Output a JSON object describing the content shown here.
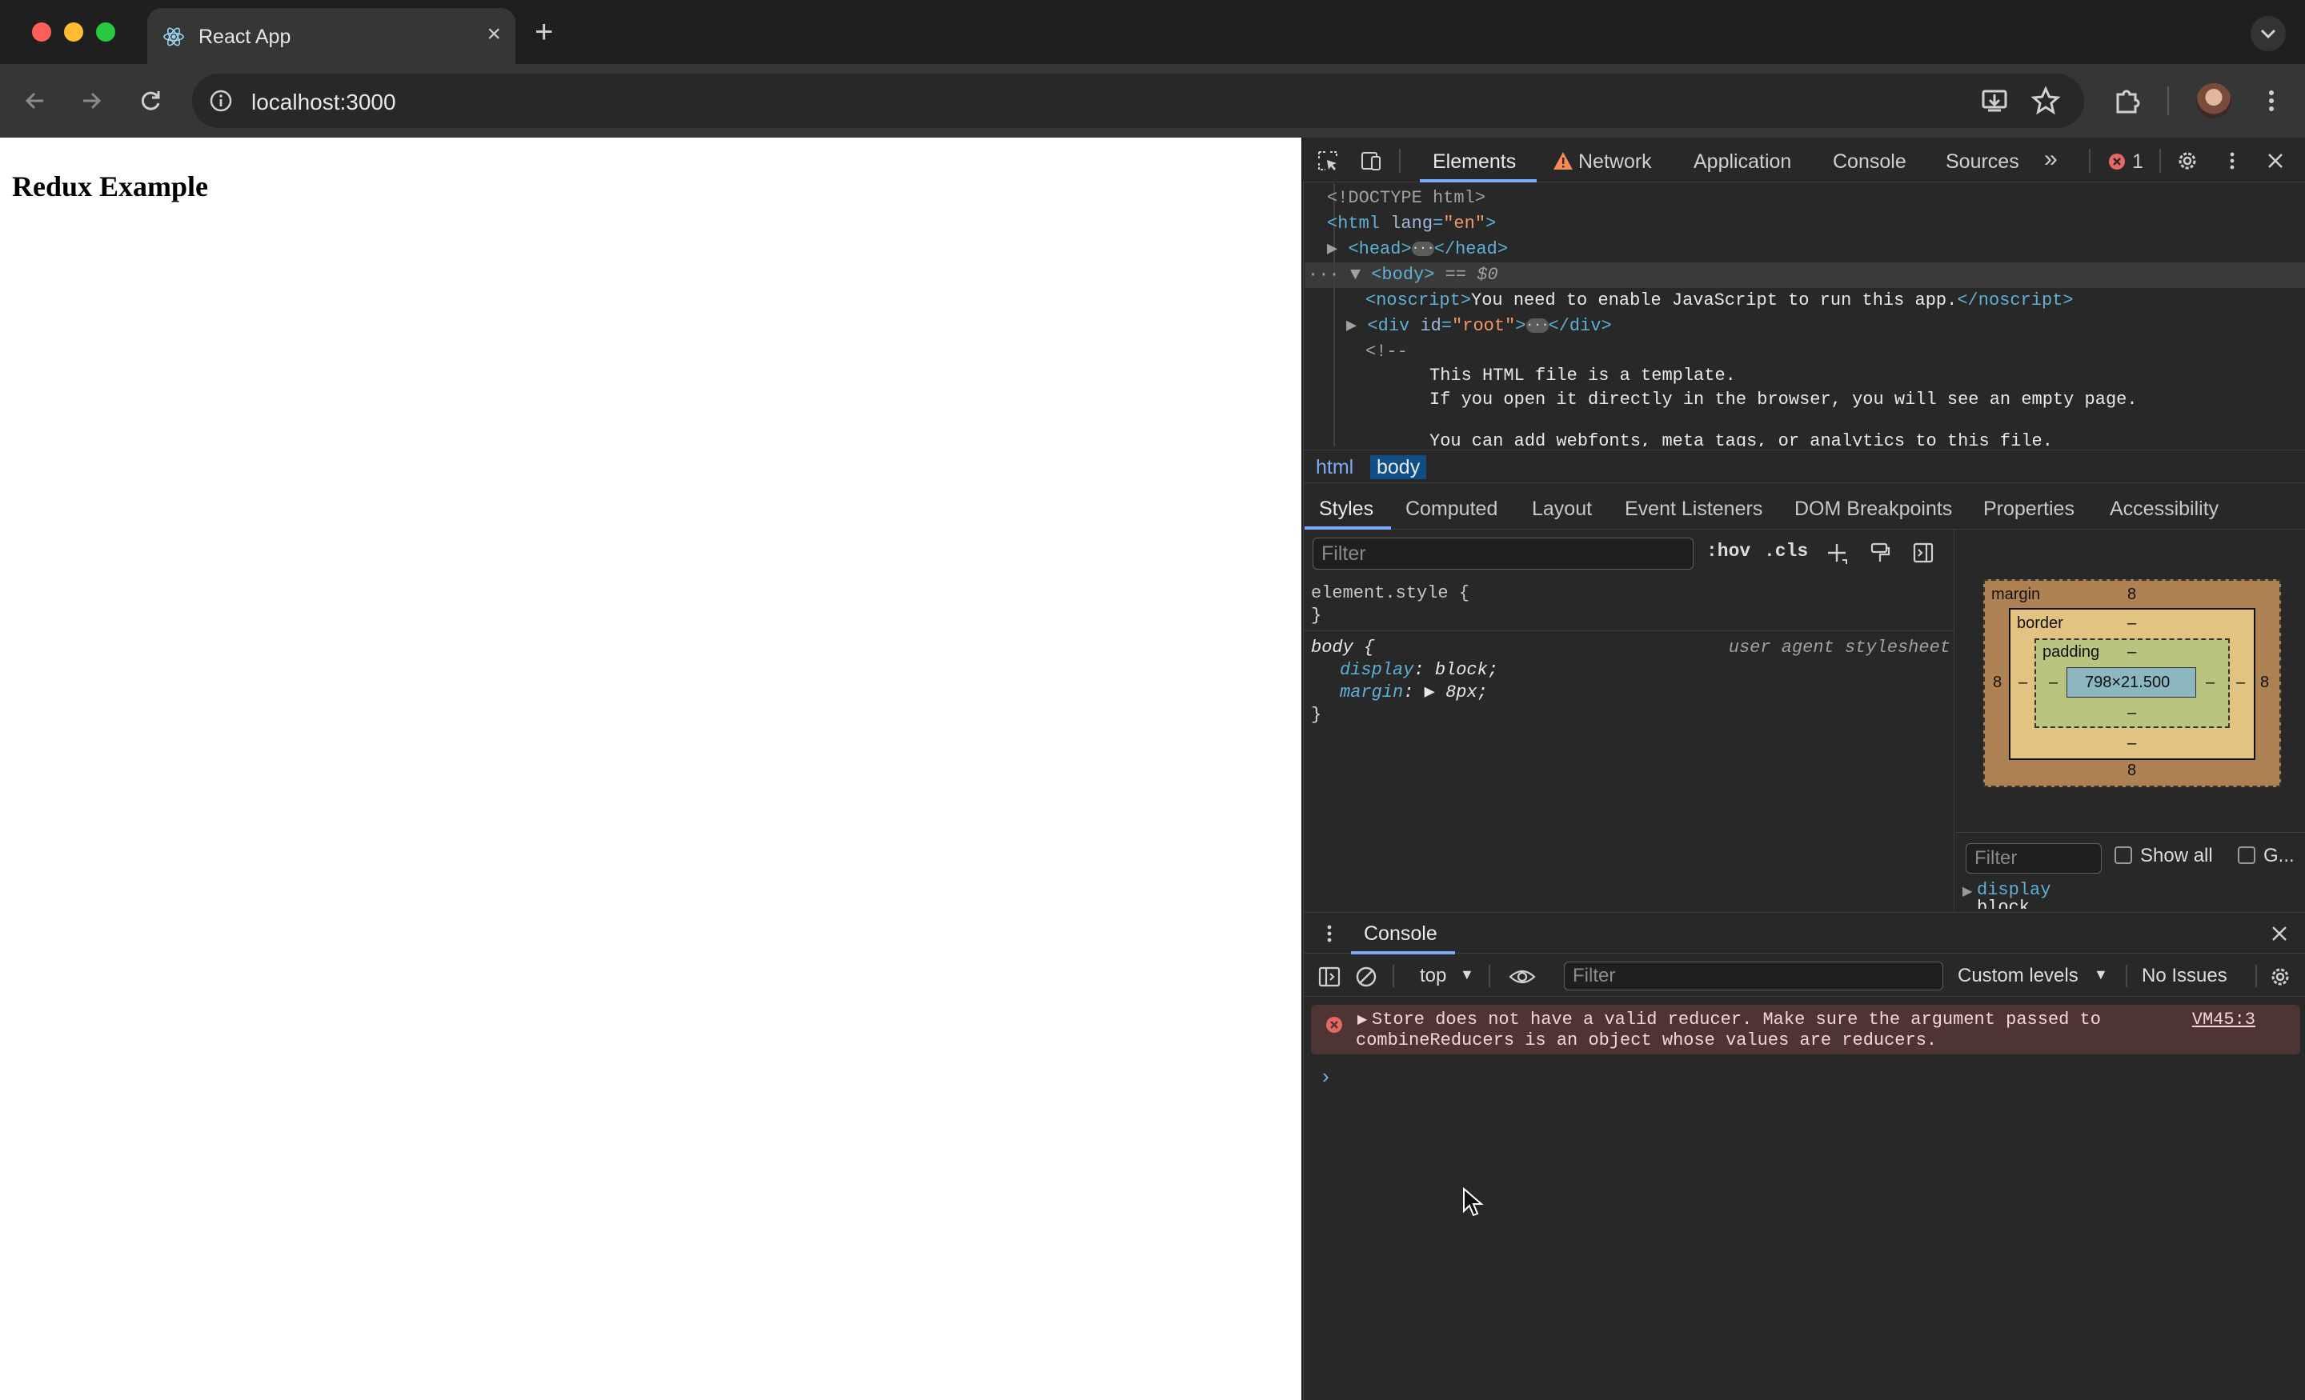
{
  "browser": {
    "tab_title": "React App",
    "tab_close": "×",
    "new_tab": "+",
    "url": "localhost:3000"
  },
  "page": {
    "heading": "Redux Example"
  },
  "devtools": {
    "tabs": {
      "elements": "Elements",
      "network": "Network",
      "application": "Application",
      "console": "Console",
      "sources": "Sources",
      "more": "»",
      "error_count": "1"
    },
    "dom": {
      "doctype": "<!DOCTYPE html>",
      "html_open": "<html",
      "lang_attr": "lang",
      "lang_val": "\"en\"",
      "gt": ">",
      "head_open": "<head>",
      "head_close": "</head>",
      "body_open": "<body>",
      "body_marker": "== $0",
      "noscript_open": "<noscript>",
      "noscript_text": "You need to enable JavaScript to run this app.",
      "noscript_close": "</noscript>",
      "div_open": "<div",
      "id_attr": "id",
      "id_val": "\"root\"",
      "div_close": "</div>",
      "comment_open": "<!--",
      "comment_line1": "This HTML file is a template.",
      "comment_line2": "If you open it directly in the browser, you will see an empty page.",
      "comment_line3": "You can add webfonts, meta tags, or analytics to this file."
    },
    "breadcrumb": [
      "html",
      "body"
    ],
    "sub_tabs": [
      "Styles",
      "Computed",
      "Layout",
      "Event Listeners",
      "DOM Breakpoints",
      "Properties",
      "Accessibility"
    ],
    "styles": {
      "filter_placeholder": "Filter",
      "hov": ":hov",
      "cls": ".cls",
      "element_style": "element.style {",
      "close_brace": "}",
      "body_selector": "body {",
      "ua_label": "user agent stylesheet",
      "display_prop": "display",
      "display_val": "block;",
      "margin_prop": "margin",
      "margin_val": "8px;"
    },
    "box_model": {
      "margin_label": "margin",
      "margin_top": "8",
      "margin_bottom": "8",
      "margin_left": "8",
      "margin_right": "8",
      "border_label": "border",
      "border_value": "–",
      "padding_label": "padding",
      "padding_value": "–",
      "content": "798×21.500"
    },
    "computed": {
      "filter_placeholder": "Filter",
      "show_all": "Show all",
      "group": "G...",
      "prop": "display",
      "val": "block"
    },
    "console": {
      "tab_label": "Console",
      "context": "top",
      "filter_placeholder": "Filter",
      "levels": "Custom levels",
      "issues": "No Issues",
      "error_message": "Store does not have a valid reducer. Make sure the argument passed to combineReducers is an object whose values are reducers.",
      "error_source": "VM45:3",
      "prompt": "›"
    }
  },
  "colors": {
    "accent": "#7cacf8",
    "error_bg": "#4e3534",
    "error_icon": "#e46962",
    "warning": "#f28b54"
  }
}
